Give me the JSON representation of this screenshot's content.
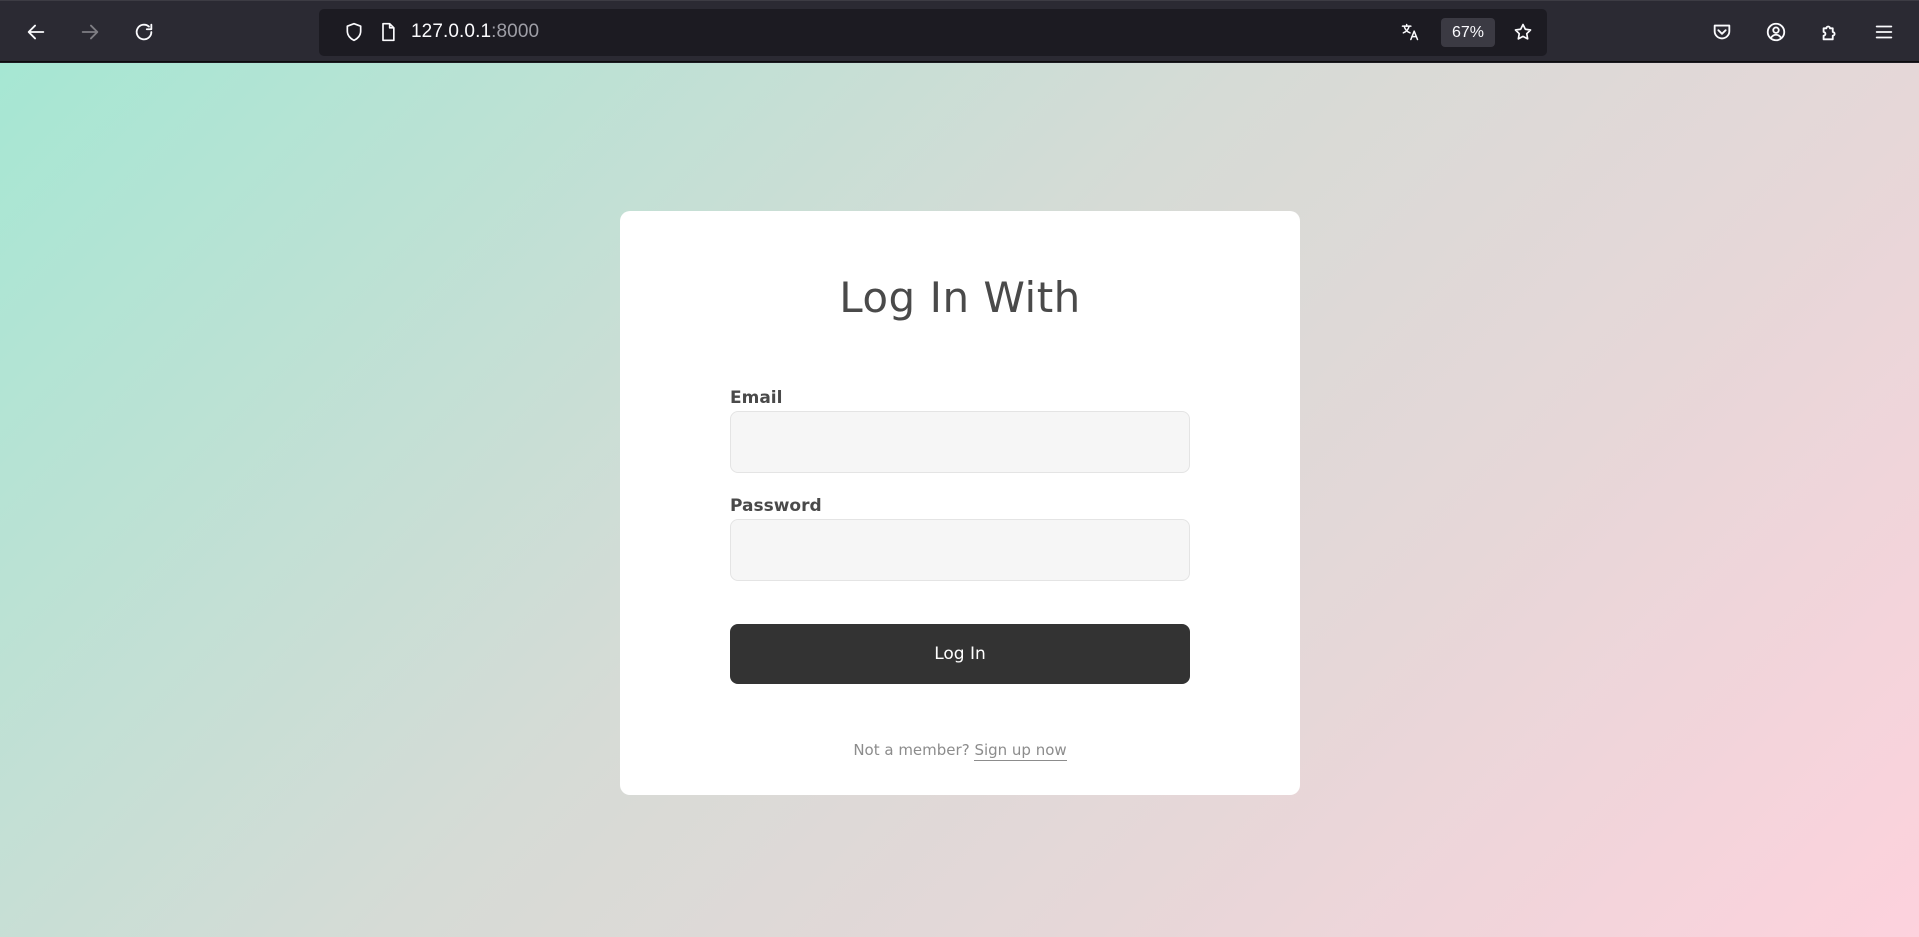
{
  "browser": {
    "url_host": "127.0.0.1",
    "url_port": ":8000",
    "zoom": "67%",
    "icons": {
      "back": "arrow-left-icon",
      "forward": "arrow-right-icon",
      "reload": "reload-icon",
      "shield": "shield-icon",
      "page": "page-icon",
      "translate": "translate-icon",
      "bookmark": "star-icon",
      "pocket": "pocket-icon",
      "account": "account-icon",
      "extensions": "extensions-icon",
      "menu": "hamburger-menu-icon"
    }
  },
  "login": {
    "title": "Log In With",
    "email_label": "Email",
    "email_value": "",
    "password_label": "Password",
    "password_value": "",
    "submit_label": "Log In",
    "signup_prompt": "Not a member?",
    "signup_link": "Sign up now"
  },
  "colors": {
    "gradient_start": "#a6e7d3",
    "gradient_end": "#fdd2dd",
    "button_bg": "#333333",
    "card_bg": "#ffffff"
  }
}
